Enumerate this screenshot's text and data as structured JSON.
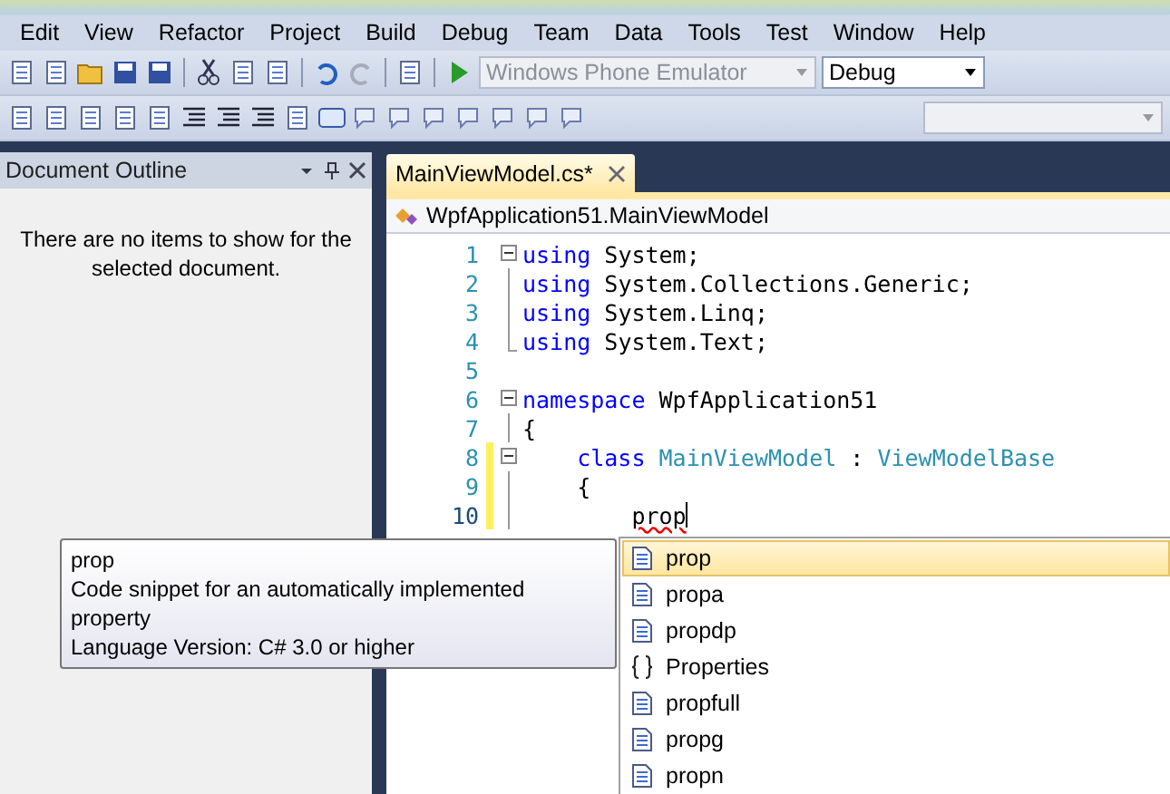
{
  "menu": [
    "Edit",
    "View",
    "Refactor",
    "Project",
    "Build",
    "Debug",
    "Team",
    "Data",
    "Tools",
    "Test",
    "Window",
    "Help"
  ],
  "toolbar": {
    "device_combo": {
      "value": "Windows Phone Emulator",
      "disabled": true
    },
    "config_combo": {
      "value": "Debug",
      "disabled": false
    }
  },
  "document_outline": {
    "title": "Document Outline",
    "message": "There are no items to show for the selected document."
  },
  "editor": {
    "tab": {
      "title": "MainViewModel.cs*"
    },
    "nav": {
      "value": "WpfApplication51.MainViewModel"
    },
    "lines": [
      {
        "number": "1",
        "kind": "start",
        "changed": false,
        "current": false,
        "tokens": [
          {
            "kind": "keyword",
            "text": "using"
          },
          {
            "kind": "plain",
            "text": " System;"
          }
        ]
      },
      {
        "number": "2",
        "kind": "inner",
        "changed": false,
        "current": false,
        "tokens": [
          {
            "kind": "keyword",
            "text": "using"
          },
          {
            "kind": "plain",
            "text": " System.Collections.Generic;"
          }
        ]
      },
      {
        "number": "3",
        "kind": "inner",
        "changed": false,
        "current": false,
        "tokens": [
          {
            "kind": "keyword",
            "text": "using"
          },
          {
            "kind": "plain",
            "text": " System.Linq;"
          }
        ]
      },
      {
        "number": "4",
        "kind": "last",
        "changed": false,
        "current": false,
        "tokens": [
          {
            "kind": "keyword",
            "text": "using"
          },
          {
            "kind": "plain",
            "text": " System.Text;"
          }
        ]
      },
      {
        "number": "5",
        "kind": "none",
        "changed": false,
        "current": false
      },
      {
        "number": "6",
        "kind": "start",
        "changed": false,
        "current": false,
        "tokens": [
          {
            "kind": "keyword",
            "text": "namespace"
          },
          {
            "kind": "plain",
            "text": " WpfApplication51"
          }
        ]
      },
      {
        "number": "7",
        "kind": "inner",
        "changed": false,
        "current": false,
        "tokens": [
          {
            "kind": "plain",
            "text": "{"
          }
        ]
      },
      {
        "number": "8",
        "kind": "start",
        "changed": true,
        "current": false,
        "tokens": [
          {
            "kind": "keyword",
            "text": "    class"
          },
          {
            "kind": "type",
            "text": " MainViewModel"
          },
          {
            "kind": "plain",
            "text": " : "
          },
          {
            "kind": "type",
            "text": "ViewModelBase"
          }
        ]
      },
      {
        "number": "9",
        "kind": "inner",
        "changed": true,
        "current": false,
        "tokens": [
          {
            "kind": "plain",
            "text": "    {"
          }
        ]
      },
      {
        "number": "10",
        "kind": "inner",
        "changed": true,
        "current": true,
        "tokens": [
          {
            "kind": "error",
            "text": "        prop"
          }
        ]
      }
    ]
  },
  "tooltip": {
    "lines": [
      "prop",
      "Code snippet for an automatically implemented property",
      "Language Version: C# 3.0 or higher"
    ]
  },
  "completion": {
    "items": [
      {
        "label": "prop",
        "kind": "snippet",
        "selected": true
      },
      {
        "label": "propa",
        "kind": "snippet",
        "selected": false
      },
      {
        "label": "propdp",
        "kind": "snippet",
        "selected": false
      },
      {
        "label": "Properties",
        "kind": "namespace",
        "selected": false
      },
      {
        "label": "propfull",
        "kind": "snippet",
        "selected": false
      },
      {
        "label": "propg",
        "kind": "snippet",
        "selected": false
      },
      {
        "label": "propn",
        "kind": "snippet",
        "selected": false
      }
    ]
  }
}
